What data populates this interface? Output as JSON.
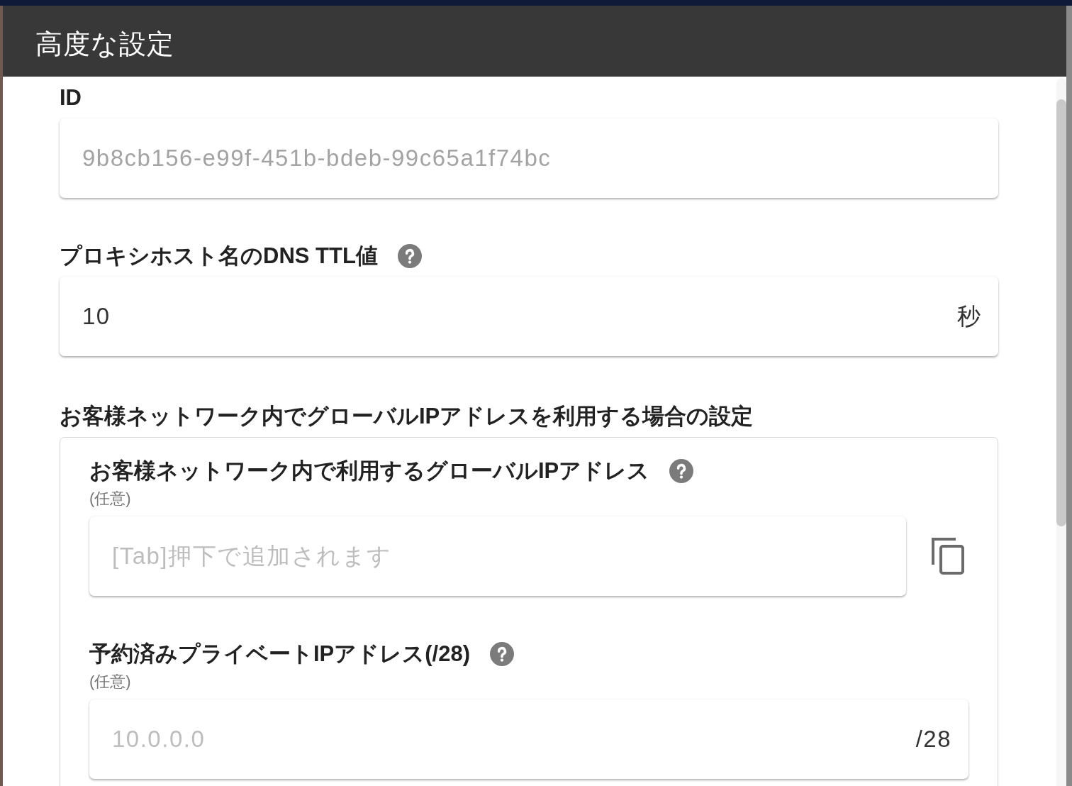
{
  "dialog": {
    "title": "高度な設定"
  },
  "fields": [
    {
      "label": "ID",
      "help": false,
      "value": "9b8cb156-e99f-451b-bdeb-99c65a1f74bc",
      "disabled": true,
      "copy_button": false
    },
    {
      "label": "プロキシホスト名のDNS TTL値",
      "help": true,
      "value": "10",
      "suffix": "秒",
      "disabled": false,
      "copy_button": false
    }
  ],
  "section": {
    "title": "お客様ネットワーク内でグローバルIPアドレスを利用する場合の設定",
    "fields": [
      {
        "label": "お客様ネットワーク内で利用するグローバルIPアドレス",
        "help": true,
        "note": "(任意)",
        "placeholder": "[Tab]押下で追加されます",
        "disabled": false,
        "copy_button": true
      },
      {
        "label": "予約済みプライベートIPアドレス(/28)",
        "help": true,
        "note": "(任意)",
        "placeholder": "10.0.0.0",
        "suffix": "/28",
        "disabled": false,
        "copy_button": false
      }
    ]
  }
}
